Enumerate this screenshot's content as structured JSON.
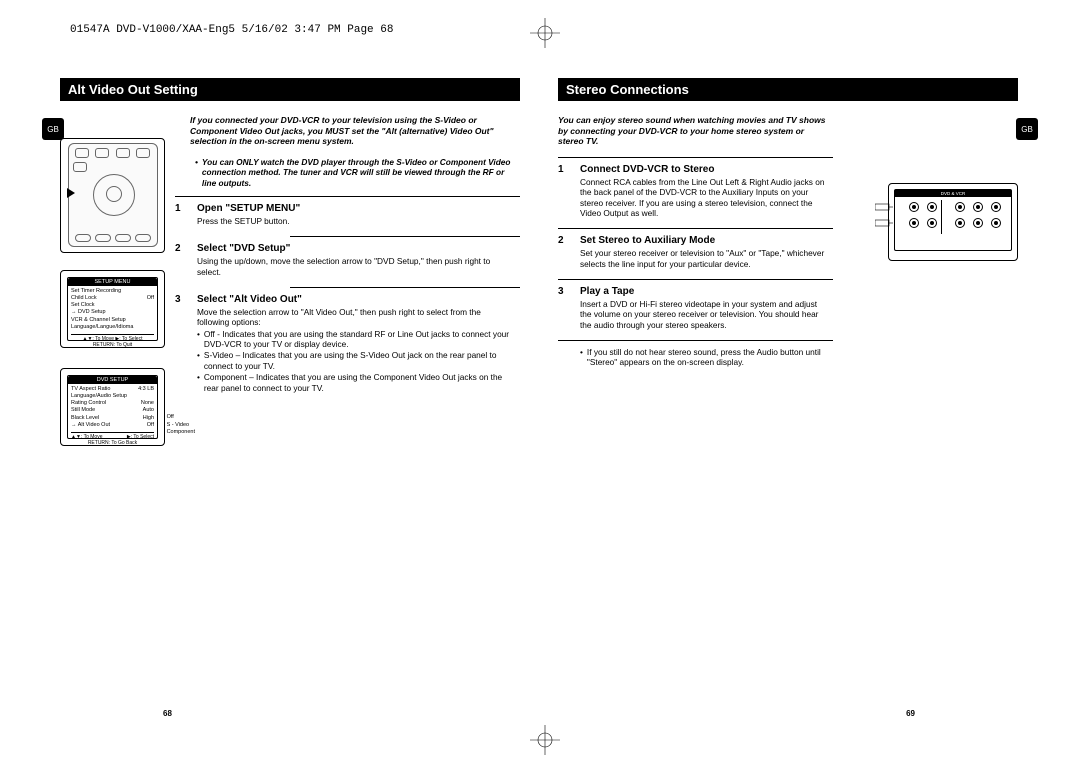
{
  "header": "01547A DVD-V1000/XAA-Eng5  5/16/02 3:47 PM  Page 68",
  "gb": "GB",
  "left": {
    "title": "Alt Video Out Setting",
    "intro": "If you connected your DVD-VCR to your television using the S-Video or Component Video Out jacks, you MUST set the \"Alt (alternative) Video Out\" selection in the on-screen menu system.",
    "note": "You can ONLY watch the DVD player through the S-Video or Component Video connection method. The tuner and VCR will still be viewed through the RF or line outputs.",
    "steps": [
      {
        "num": "1",
        "title": "Open \"SETUP MENU\"",
        "text": "Press the SETUP button."
      },
      {
        "num": "2",
        "title": "Select \"DVD Setup\"",
        "text": "Using the up/down, move the selection arrow to \"DVD Setup,\" then push right to select."
      },
      {
        "num": "3",
        "title": "Select \"Alt Video Out\"",
        "text": "Move the selection arrow to \"Alt Video Out,\" then push right to select from the following options:",
        "subs": [
          "Off - Indicates that you are using the standard RF or Line Out jacks to connect your DVD-VCR to your TV or display device.",
          "S-Video – Indicates that you are using the S-Video Out jack on the rear panel to connect to your TV.",
          "Component – Indicates that you are using the Component Video Out jacks on the rear panel to connect to your TV."
        ]
      }
    ],
    "menu1": {
      "header": "SETUP MENU",
      "items": [
        {
          "l": "Set Timer Recording",
          "r": ""
        },
        {
          "l": "Child Lock",
          "r": "Off"
        },
        {
          "l": "Set Clock",
          "r": ""
        },
        {
          "l": "→ DVD Setup",
          "r": ""
        },
        {
          "l": "VCR & Channel Setup",
          "r": ""
        },
        {
          "l": "Language/Langue/Idioma",
          "r": ""
        }
      ],
      "footer1": "▲▼: To Move        ▶: To Select",
      "footer2": "RETURN: To Quit"
    },
    "menu2": {
      "header": "DVD SETUP",
      "items": [
        {
          "l": "TV Aspect Ratio",
          "r": "4:3 LB"
        },
        {
          "l": "Language/Audio Setup",
          "r": ""
        },
        {
          "l": "Rating Control",
          "r": "None"
        },
        {
          "l": "Still Mode",
          "r": "Auto"
        },
        {
          "l": "Black Level",
          "r": "High"
        },
        {
          "l": "→ Alt Video Out",
          "r": "Off"
        }
      ],
      "side": [
        "Off",
        "S - Video",
        "Component"
      ],
      "footer1a": "▲▼: To Move",
      "footer1b": "▶: To Select",
      "footer2": "RETURN: To Go Back"
    },
    "pagenum": "68"
  },
  "right": {
    "title": "Stereo Connections",
    "intro": "You can enjoy stereo sound when watching movies and TV shows by connecting your DVD-VCR to your home stereo system or stereo TV.",
    "steps": [
      {
        "num": "1",
        "title": "Connect DVD-VCR to Stereo",
        "text": "Connect RCA cables from the Line Out Left & Right Audio jacks on the back panel of the DVD-VCR to the Auxiliary Inputs on your stereo receiver. If you are using a stereo television, connect the Video Output as well."
      },
      {
        "num": "2",
        "title": "Set Stereo to Auxiliary Mode",
        "text": "Set your stereo receiver or television to \"Aux\" or \"Tape,\" whichever selects the line input for your particular device."
      },
      {
        "num": "3",
        "title": "Play a Tape",
        "text": "Insert a DVD or Hi-Fi stereo videotape in your system and adjust the volume on your stereo receiver or television. You should hear the audio through your stereo speakers."
      }
    ],
    "final": "If you still do not hear stereo sound, press the Audio button until \"Stereo\" appears on the on-screen display.",
    "panel_label": "DVD & VCR",
    "pagenum": "69"
  }
}
